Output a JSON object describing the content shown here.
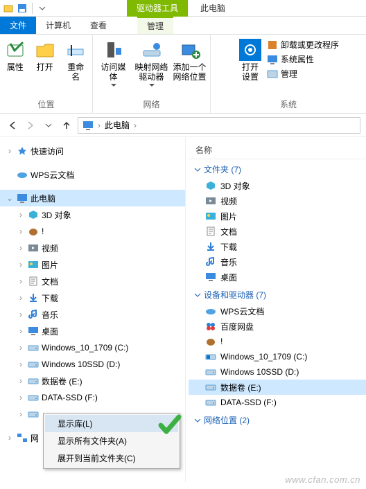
{
  "titlebar": {
    "context_tab": "驱动器工具",
    "title": "此电脑"
  },
  "tabs": {
    "file": "文件",
    "computer": "计算机",
    "view": "查看",
    "manage": "管理"
  },
  "ribbon": {
    "group_location": {
      "label": "位置",
      "properties": "属性",
      "open": "打开",
      "rename": "重命名"
    },
    "group_network": {
      "label": "网络",
      "access_media": "访问媒体",
      "map_drive": "映射网络\n驱动器",
      "add_location": "添加一个\n网络位置"
    },
    "group_system": {
      "label": "系统",
      "open_settings": "打开\n设置",
      "uninstall": "卸载或更改程序",
      "sys_props": "系统属性",
      "manage": "管理"
    }
  },
  "nav": {
    "current": "此电脑"
  },
  "tree": {
    "quick_access": "快速访问",
    "wps": "WPS云文档",
    "this_pc": "此电脑",
    "children": [
      {
        "label": "3D 对象",
        "icon": "cube-icon"
      },
      {
        "label": "!",
        "icon": "nut-icon"
      },
      {
        "label": "视频",
        "icon": "video-icon"
      },
      {
        "label": "图片",
        "icon": "pictures-icon"
      },
      {
        "label": "文档",
        "icon": "document-icon"
      },
      {
        "label": "下载",
        "icon": "download-icon"
      },
      {
        "label": "音乐",
        "icon": "music-icon"
      },
      {
        "label": "桌面",
        "icon": "desktop-icon"
      },
      {
        "label": "Windows_10_1709 (C:)",
        "icon": "drive-icon"
      },
      {
        "label": "Windows 10SSD (D:)",
        "icon": "drive-icon"
      },
      {
        "label": "数据卷 (E:)",
        "icon": "drive-icon"
      },
      {
        "label": "DATA-SSD (F:)",
        "icon": "drive-icon"
      },
      {
        "label": "",
        "icon": "drive-icon"
      }
    ],
    "network_trunc": "网"
  },
  "main": {
    "column_name": "名称",
    "group_folders": "文件夹 (7)",
    "folders": [
      {
        "label": "3D 对象",
        "icon": "cube-icon"
      },
      {
        "label": "视频",
        "icon": "video-icon"
      },
      {
        "label": "图片",
        "icon": "pictures-icon"
      },
      {
        "label": "文档",
        "icon": "document-icon"
      },
      {
        "label": "下载",
        "icon": "download-icon"
      },
      {
        "label": "音乐",
        "icon": "music-icon"
      },
      {
        "label": "桌面",
        "icon": "desktop-icon"
      }
    ],
    "group_drives": "设备和驱动器 (7)",
    "drives": [
      {
        "label": "WPS云文档",
        "icon": "cloud-icon"
      },
      {
        "label": "百度网盘",
        "icon": "baidu-icon"
      },
      {
        "label": "!",
        "icon": "nut-icon"
      },
      {
        "label": "Windows_10_1709 (C:)",
        "icon": "drive-win-icon"
      },
      {
        "label": "Windows 10SSD (D:)",
        "icon": "drive-icon"
      },
      {
        "label": "数据卷 (E:)",
        "icon": "drive-icon",
        "selected": true
      },
      {
        "label": "DATA-SSD (F:)",
        "icon": "drive-icon"
      }
    ],
    "group_netloc": "网络位置 (2)"
  },
  "context_menu": {
    "show_libs": "显示库(L)",
    "show_all": "显示所有文件夹(A)",
    "expand": "展开到当前文件夹(C)"
  },
  "watermark": "www.cfan.com.cn"
}
